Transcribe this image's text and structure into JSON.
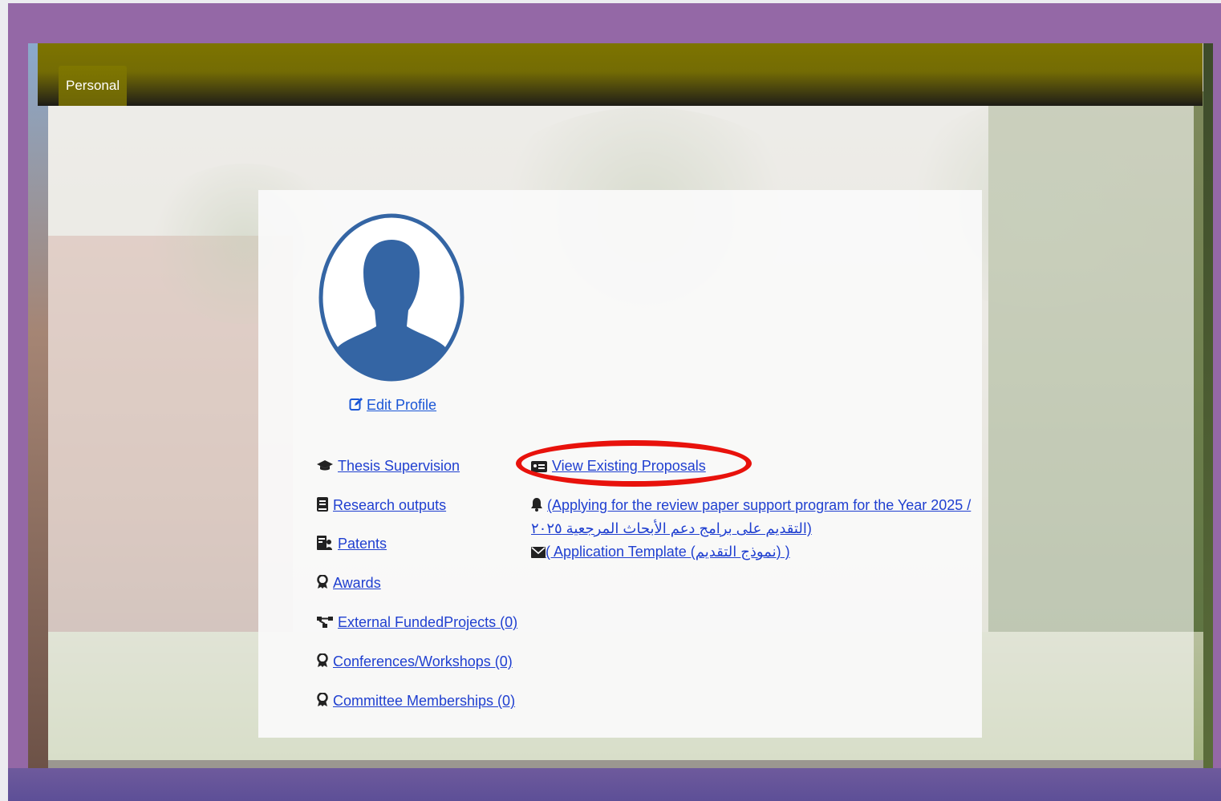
{
  "navbar": {
    "tabs": [
      {
        "label": "Personal"
      }
    ]
  },
  "profile": {
    "edit_label": "Edit Profile"
  },
  "left_links": [
    {
      "label": "Thesis Supervision",
      "icon": "graduation-cap-icon"
    },
    {
      "label": "Research outputs",
      "icon": "book-icon"
    },
    {
      "label": "Patents",
      "icon": "patent-icon"
    },
    {
      "label": "Awards",
      "icon": "award-icon"
    },
    {
      "label": "External FundedProjects (0)",
      "icon": "project-diagram-icon"
    },
    {
      "label": "Conferences/Workshops (0)",
      "icon": "award-icon"
    },
    {
      "label": "Committee Memberships (0)",
      "icon": "award-icon"
    }
  ],
  "right_links": {
    "view_proposals": {
      "label": "View Existing Proposals",
      "icon": "id-card-icon"
    },
    "review_paper": {
      "line1": "(Applying for the review paper support program for the Year 2025 /",
      "line2": "(التقديم على برامج دعم الأبحاث المرجعية ٢٠٢٥",
      "icon": "bell-icon"
    },
    "template": {
      "label": "( Application Template (نموذج التقديم) )",
      "icon": "envelope-icon"
    }
  },
  "colors": {
    "frame": "#9468a6",
    "navbar": "#7d7400",
    "link": "#1f3fd0",
    "avatar": "#3465a4",
    "highlight": "#e8120c"
  }
}
